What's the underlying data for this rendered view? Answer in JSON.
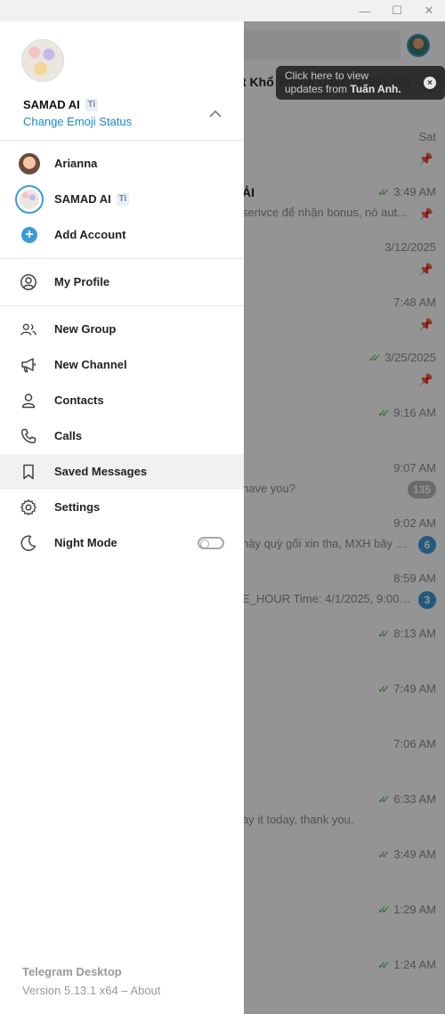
{
  "window": {
    "minimize_glyph": "—",
    "maximize_glyph": "☐",
    "close_glyph": "✕"
  },
  "tooltip": {
    "line1": "Click here to view",
    "line2_prefix": "updates from ",
    "line2_name": "Tuấn Anh.",
    "close_glyph": "×"
  },
  "chats": [
    {
      "name": "t Khổ Thành Đại Gia. 99VINA -...",
      "time": "",
      "checks": false,
      "msg": "",
      "badge": "9",
      "badge_muted": true,
      "pinned": false
    },
    {
      "name": "",
      "time": "Sat",
      "checks": false,
      "msg": "",
      "badge": "",
      "badge_muted": false,
      "pinned": true
    },
    {
      "name": "ẢI",
      "time": "3:49 AM",
      "checks": true,
      "msg": "serivce để nhận bonus, nó aut...",
      "badge": "",
      "badge_muted": false,
      "pinned": true
    },
    {
      "name": "",
      "time": "3/12/2025",
      "checks": false,
      "msg": "",
      "badge": "",
      "badge_muted": false,
      "pinned": true
    },
    {
      "name": "",
      "time": "7:48 AM",
      "checks": false,
      "msg": "",
      "badge": "",
      "badge_muted": false,
      "pinned": true
    },
    {
      "name": "",
      "time": "3/25/2025",
      "checks": true,
      "msg": "",
      "badge": "",
      "badge_muted": false,
      "pinned": true
    },
    {
      "name": "",
      "time": "9:16 AM",
      "checks": true,
      "msg": "",
      "badge": "",
      "badge_muted": false,
      "pinned": false
    },
    {
      "name": "",
      "time": "9:07 AM",
      "checks": false,
      "msg": "have you?",
      "badge": "135",
      "badge_muted": true,
      "pinned": false
    },
    {
      "name": "",
      "time": "9:02 AM",
      "checks": false,
      "msg": "này quỳ gối xin tha, MXH bây g...",
      "badge": "6",
      "badge_muted": false,
      "pinned": false
    },
    {
      "name": "",
      "time": "8:59 AM",
      "checks": false,
      "msg": "E_HOUR Time: 4/1/2025, 9:00:00...",
      "badge": "3",
      "badge_muted": false,
      "pinned": false
    },
    {
      "name": "",
      "time": "8:13 AM",
      "checks": true,
      "msg": "",
      "badge": "",
      "badge_muted": false,
      "pinned": false
    },
    {
      "name": "",
      "time": "7:49 AM",
      "checks": true,
      "msg": "",
      "badge": "",
      "badge_muted": false,
      "pinned": false
    },
    {
      "name": "",
      "time": "7:06 AM",
      "checks": false,
      "msg": "",
      "badge": "",
      "badge_muted": false,
      "pinned": false
    },
    {
      "name": "",
      "time": "6:33 AM",
      "checks": true,
      "msg": "ay it today, thank you.",
      "badge": "",
      "badge_muted": false,
      "pinned": false
    },
    {
      "name": "",
      "time": "3:49 AM",
      "checks": true,
      "msg": "",
      "badge": "",
      "badge_muted": false,
      "pinned": false
    },
    {
      "name": "",
      "time": "1:29 AM",
      "checks": true,
      "msg": "",
      "badge": "",
      "badge_muted": false,
      "pinned": false
    },
    {
      "name": "",
      "time": "1:24 AM",
      "checks": true,
      "msg": "",
      "badge": "",
      "badge_muted": false,
      "pinned": false
    }
  ],
  "menu": {
    "user_name": "SAMAD AI",
    "emoji_status": "Ti",
    "change_emoji_status": "Change Emoji Status",
    "accounts": [
      {
        "name": "Arianna"
      },
      {
        "name": "SAMAD AI"
      }
    ],
    "add_account": "Add Account",
    "my_profile": "My Profile",
    "new_group": "New Group",
    "new_channel": "New Channel",
    "contacts": "Contacts",
    "calls": "Calls",
    "saved_messages": "Saved Messages",
    "settings": "Settings",
    "night_mode": "Night Mode",
    "night_mode_enabled": false,
    "active_item": "saved_messages"
  },
  "footer": {
    "app_name": "Telegram Desktop",
    "version": "Version 5.13.1 x64 – About"
  },
  "colors": {
    "accent": "#3a9bd9",
    "link": "#168acd",
    "check_green": "#4fae4e"
  }
}
